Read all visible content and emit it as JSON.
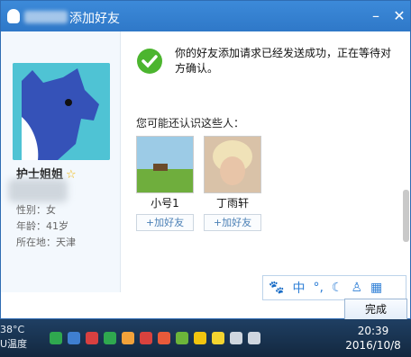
{
  "window": {
    "title": "添加好友"
  },
  "profile": {
    "name": "护士姐姐",
    "gender": "性别：女",
    "age": "年龄：41岁",
    "location": "所在地：天津"
  },
  "message": "你的好友添加请求已经发送成功，正在等待对方确认。",
  "suggest_title": "您可能还认识这些人：",
  "suggestions": [
    {
      "name": "小号1",
      "add_label": "+加好友"
    },
    {
      "name": "丁雨轩",
      "add_label": "+加好友"
    }
  ],
  "ime": {
    "icons": [
      "paw-icon",
      "chinese-icon",
      "punctuation-icon",
      "moon-icon",
      "user-icon",
      "grid-icon"
    ],
    "mode_label": "中"
  },
  "done_label": "完成",
  "taskbar": {
    "temp_value": "38°C",
    "temp_label": "U温度",
    "time": "20:39",
    "date": "2016/10/8"
  }
}
